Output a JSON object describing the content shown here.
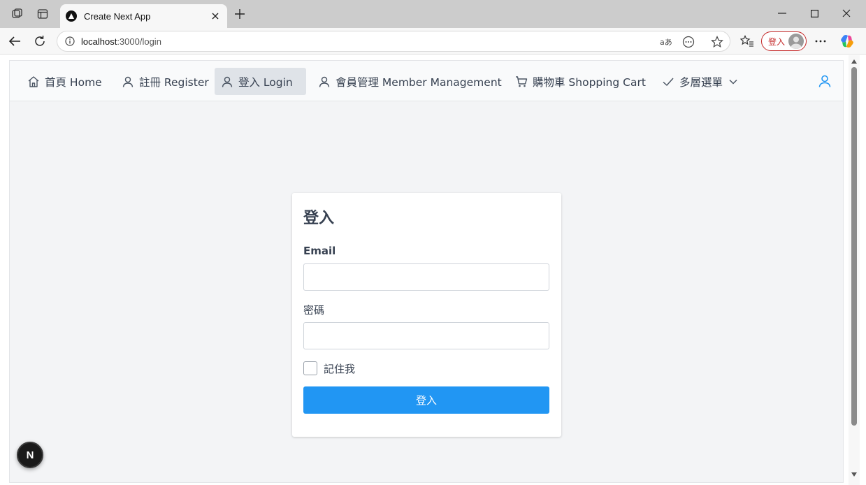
{
  "browser": {
    "tab_title": "Create Next App",
    "url_host": "localhost",
    "url_rest": ":3000/login",
    "profile_label": "登入"
  },
  "nav": {
    "items": [
      {
        "label": "首頁 Home",
        "icon": "home-icon"
      },
      {
        "label": "註冊 Register",
        "icon": "user-icon"
      },
      {
        "label": "登入 Login",
        "icon": "user-icon",
        "active": true
      },
      {
        "label": "會員管理 Member Management",
        "icon": "user-icon"
      },
      {
        "label": "購物車 Shopping Cart",
        "icon": "cart-icon"
      },
      {
        "label": "多層選單",
        "icon": "check-icon",
        "dropdown": true
      }
    ]
  },
  "login": {
    "title": "登入",
    "email_label": "Email",
    "email_value": "",
    "password_label": "密碼",
    "password_value": "",
    "remember_label": "記住我",
    "submit_label": "登入"
  },
  "dev_badge": "N",
  "colors": {
    "accent": "#2196f3",
    "active_nav_bg": "#dfe3e8",
    "page_bg": "#f3f4f6",
    "profile_border": "#c52a2a"
  }
}
